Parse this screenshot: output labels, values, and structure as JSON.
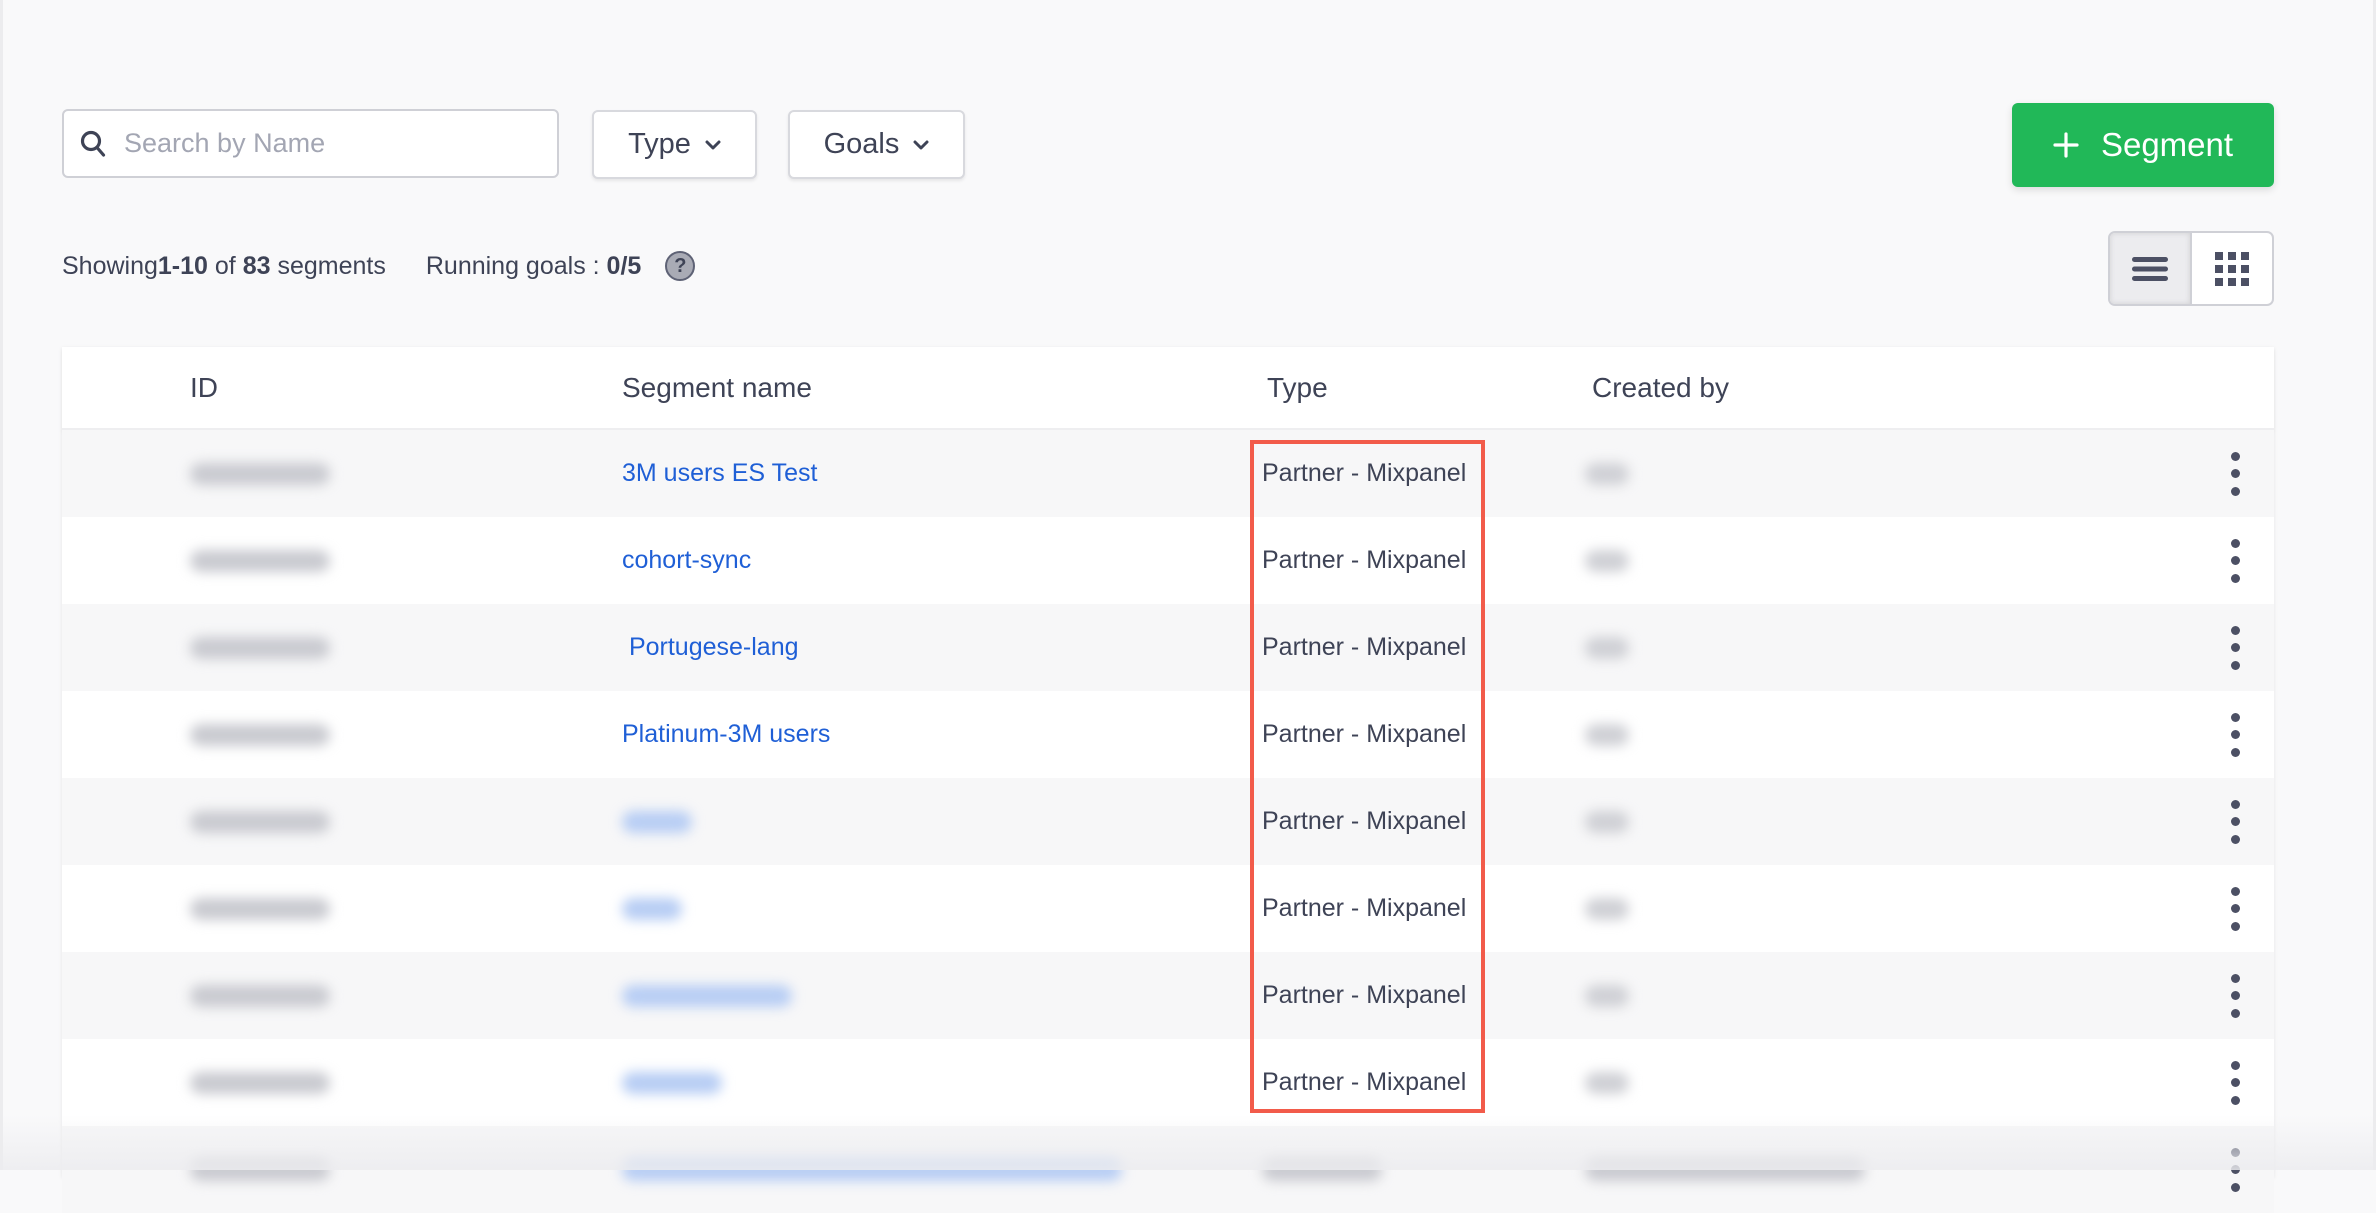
{
  "toolbar": {
    "search_placeholder": "Search by Name",
    "search_value": "",
    "filters": [
      {
        "label": "Type"
      },
      {
        "label": "Goals"
      }
    ],
    "add_button_label": "Segment",
    "add_button_color": "#21b858"
  },
  "summary": {
    "prefix": "Showing ",
    "range": "1-10",
    "of_text": " of ",
    "total": "83",
    "suffix": " segments",
    "running_goals_label": "Running goals : ",
    "running_goals_value": "0/5",
    "help_icon": "?"
  },
  "view_toggle": {
    "options": [
      "list-view",
      "grid-view"
    ],
    "active": "list-view"
  },
  "table": {
    "columns": [
      "ID",
      "Segment name",
      "Type",
      "Created by"
    ],
    "rows": [
      {
        "id": "[redacted]",
        "name": "3M users ES Test",
        "type": "Partner - Mixpanel",
        "created_by": "[redacted]"
      },
      {
        "id": "[redacted]",
        "name": "cohort-sync",
        "type": "Partner - Mixpanel",
        "created_by": "[redacted]"
      },
      {
        "id": "[redacted]",
        "name": " Portugese-lang",
        "type": "Partner - Mixpanel",
        "created_by": "[redacted]"
      },
      {
        "id": "[redacted]",
        "name": "Platinum-3M users",
        "type": "Partner - Mixpanel",
        "created_by": "[redacted]"
      },
      {
        "id": "[redacted]",
        "name": "[redacted]",
        "type": "Partner - Mixpanel",
        "created_by": "[redacted]"
      },
      {
        "id": "[redacted]",
        "name": "[redacted]",
        "type": "Partner - Mixpanel",
        "created_by": "[redacted]"
      },
      {
        "id": "[redacted]",
        "name": "[redacted]",
        "type": "Partner - Mixpanel",
        "created_by": "[redacted]"
      },
      {
        "id": "[redacted]",
        "name": "[redacted]",
        "type": "Partner - Mixpanel",
        "created_by": "[redacted]"
      },
      {
        "id": "[redacted]",
        "name": "[redacted]",
        "type": "[redacted]",
        "created_by": "[redacted]"
      }
    ]
  },
  "annotation": {
    "highlight_color": "#f25b4a",
    "target": "Type column values"
  }
}
